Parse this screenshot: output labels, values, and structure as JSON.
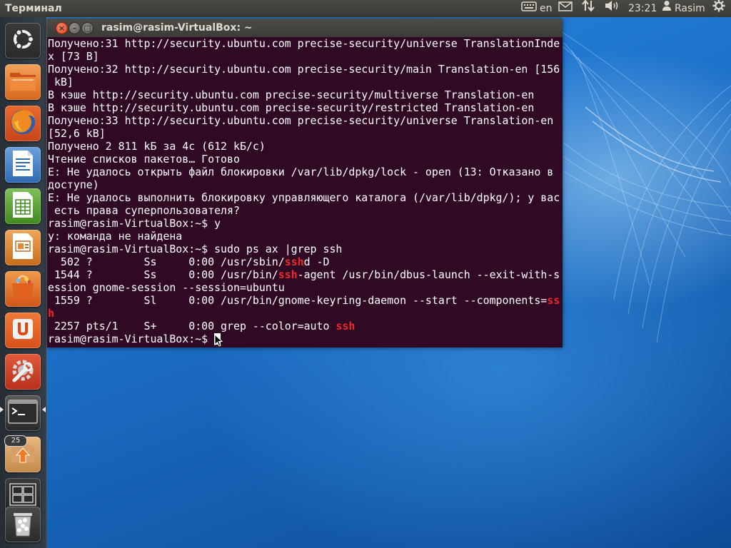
{
  "panel": {
    "app_title": "Терминал",
    "keyboard_layout": "en",
    "clock": "23:21",
    "user_name": "Rasim",
    "icons": [
      "keyboard-icon",
      "mail-icon",
      "network-icon",
      "volume-icon",
      "user-icon",
      "gear-icon"
    ]
  },
  "launcher": {
    "items": [
      {
        "name": "dash-home",
        "icon": "ubuntu-logo-icon"
      },
      {
        "name": "files",
        "icon": "folder-icon"
      },
      {
        "name": "firefox",
        "icon": "firefox-icon"
      },
      {
        "name": "libreoffice-writer",
        "icon": "writer-icon"
      },
      {
        "name": "libreoffice-calc",
        "icon": "calc-icon"
      },
      {
        "name": "libreoffice-impress",
        "icon": "impress-icon"
      },
      {
        "name": "software-center",
        "icon": "shopping-bag-icon"
      },
      {
        "name": "ubuntu-one",
        "icon": "ubuntu-one-icon"
      },
      {
        "name": "system-settings",
        "icon": "settings-wrench-icon"
      },
      {
        "name": "terminal",
        "icon": "terminal-icon"
      },
      {
        "name": "update-manager",
        "icon": "update-arrow-icon"
      },
      {
        "name": "workspace-switcher",
        "icon": "workspaces-icon"
      },
      {
        "name": "trash",
        "icon": "trash-icon"
      }
    ],
    "update_badge": "25"
  },
  "window": {
    "title": "rasim@rasim-VirtualBox: ~",
    "close_glyph": "×",
    "minimize_glyph": "–",
    "maximize_glyph": "□"
  },
  "terminal": {
    "colors": {
      "background": "#300a24",
      "text": "#ffffff",
      "highlight": "#ef2929"
    },
    "lines": [
      [
        {
          "t": "Получено:31 http://security.ubuntu.com precise-security/universe TranslationInde"
        }
      ],
      [
        {
          "t": "x [73 B]"
        }
      ],
      [
        {
          "t": "Получено:32 http://security.ubuntu.com precise-security/main Translation-en [156"
        }
      ],
      [
        {
          "t": " kB]"
        }
      ],
      [
        {
          "t": "В кэше http://security.ubuntu.com precise-security/multiverse Translation-en"
        }
      ],
      [
        {
          "t": "В кэше http://security.ubuntu.com precise-security/restricted Translation-en"
        }
      ],
      [
        {
          "t": "Получено:33 http://security.ubuntu.com precise-security/universe Translation-en"
        }
      ],
      [
        {
          "t": "[52,6 kB]"
        }
      ],
      [
        {
          "t": "Получено 2 811 kБ за 4с (612 kБ/c)"
        }
      ],
      [
        {
          "t": "Чтение списков пакетов… Готово"
        }
      ],
      [
        {
          "t": "E: Не удалось открыть файл блокировки /var/lib/dpkg/lock - open (13: Отказано в"
        }
      ],
      [
        {
          "t": "доступе)"
        }
      ],
      [
        {
          "t": "E: Не удалось выполнить блокировку управляющего каталога (/var/lib/dpkg/); у вас"
        }
      ],
      [
        {
          "t": " есть права суперпользователя?"
        }
      ],
      [
        {
          "t": "rasim@rasim-VirtualBox:~$ y"
        }
      ],
      [
        {
          "t": "y: команда не найдена"
        }
      ],
      [
        {
          "t": "rasim@rasim-VirtualBox:~$ sudo ps ax |grep ssh"
        }
      ],
      [
        {
          "t": "  502 ?        Ss     0:00 /usr/sbin/"
        },
        {
          "t": "ssh",
          "hl": true
        },
        {
          "t": "d -D"
        }
      ],
      [
        {
          "t": " 1544 ?        Ss     0:00 /usr/bin/"
        },
        {
          "t": "ssh",
          "hl": true
        },
        {
          "t": "-agent /usr/bin/dbus-launch --exit-with-s"
        }
      ],
      [
        {
          "t": "ession gnome-session --session=ubuntu"
        }
      ],
      [
        {
          "t": " 1559 ?        Sl     0:00 /usr/bin/gnome-keyring-daemon --start --components="
        },
        {
          "t": "ss",
          "hl": true
        }
      ],
      [
        {
          "t": "h",
          "hl": true
        }
      ],
      [
        {
          "t": " 2257 pts/1    S+     0:00 grep --color=auto "
        },
        {
          "t": "ssh",
          "hl": true
        }
      ]
    ],
    "prompt": "rasim@rasim-VirtualBox:~$ "
  }
}
